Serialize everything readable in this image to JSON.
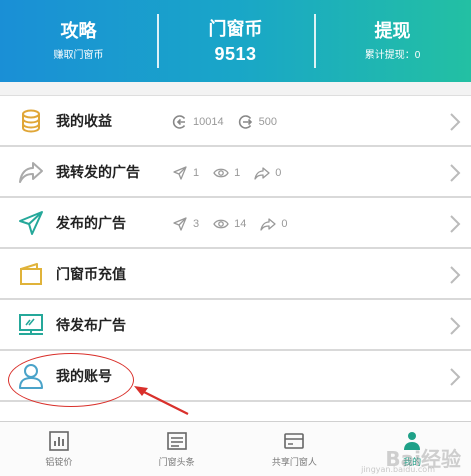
{
  "header": {
    "strategy": {
      "title": "攻略",
      "sub": "赚取门窗币"
    },
    "coins": {
      "title": "门窗币",
      "value": "9513"
    },
    "withdraw": {
      "title": "提现",
      "sub": "累计提现：0"
    }
  },
  "menu": [
    {
      "label": "我的收益",
      "icon": "coins-stack-icon",
      "stats": [
        {
          "icon": "income-icon",
          "value": "10014"
        },
        {
          "icon": "expense-icon",
          "value": "500"
        }
      ]
    },
    {
      "label": "我转发的广告",
      "icon": "forward-share-icon",
      "stats": [
        {
          "icon": "send-icon",
          "value": "1"
        },
        {
          "icon": "eye-icon",
          "value": "1"
        },
        {
          "icon": "share-icon",
          "value": "0"
        }
      ]
    },
    {
      "label": "发布的广告",
      "icon": "paper-plane-icon",
      "stats": [
        {
          "icon": "send-icon",
          "value": "3"
        },
        {
          "icon": "eye-icon",
          "value": "14"
        },
        {
          "icon": "share-icon",
          "value": "0"
        }
      ]
    },
    {
      "label": "门窗币充值",
      "icon": "wallet-icon",
      "stats": []
    },
    {
      "label": "待发布广告",
      "icon": "presentation-board-icon",
      "stats": []
    },
    {
      "label": "我的账号",
      "icon": "user-icon",
      "stats": []
    }
  ],
  "bottom_nav": [
    {
      "label": "铝锭价",
      "icon": "bar-chart-icon"
    },
    {
      "label": "门窗头条",
      "icon": "news-icon"
    },
    {
      "label": "共享门窗人",
      "icon": "card-icon"
    },
    {
      "label": "我的",
      "icon": "person-icon",
      "active": true
    }
  ],
  "watermark": {
    "text": "Bai经验",
    "sub": "jingyan.baidu.com"
  },
  "colors": {
    "header_start": "#1a8fd6",
    "header_end": "#23c0a3",
    "accent": "#1fa188",
    "annotation": "#d9302b"
  }
}
